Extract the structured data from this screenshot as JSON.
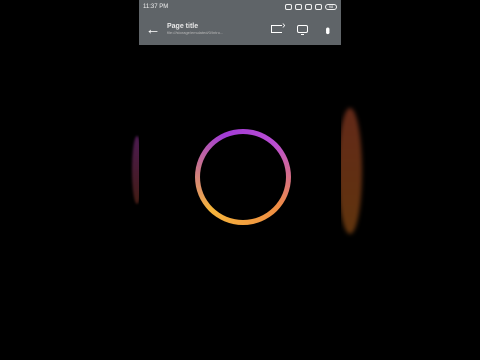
{
  "statusbar": {
    "time": "11:37 PM",
    "battery": "98"
  },
  "toolbar": {
    "title": "Page title",
    "url": "file:///storage/emulated/0/Intro...",
    "back_icon": "arrow-left-icon",
    "share_icon": "share-icon",
    "desktop_icon": "monitor-icon",
    "menu_icon": "more-vert-icon"
  },
  "content": {
    "accent_colors": [
      "#a13bd6",
      "#f08d43",
      "#f6b53b"
    ]
  }
}
